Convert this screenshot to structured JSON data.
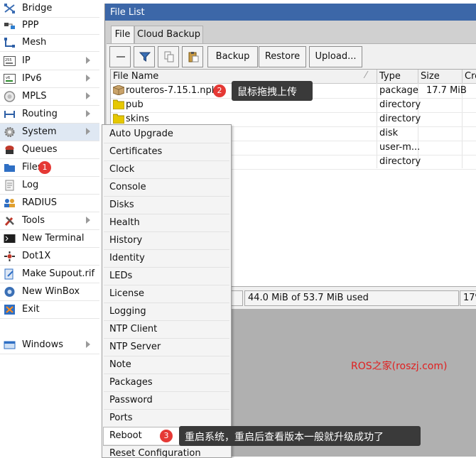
{
  "sidebar": {
    "items": [
      {
        "label": "Bridge",
        "icon": "bridge-icon",
        "submenu": false
      },
      {
        "label": "PPP",
        "icon": "ppp-icon",
        "submenu": false
      },
      {
        "label": "Mesh",
        "icon": "mesh-icon",
        "submenu": false
      },
      {
        "label": "IP",
        "icon": "ip-icon",
        "submenu": true
      },
      {
        "label": "IPv6",
        "icon": "ipv6-icon",
        "submenu": true
      },
      {
        "label": "MPLS",
        "icon": "mpls-icon",
        "submenu": true
      },
      {
        "label": "Routing",
        "icon": "routing-icon",
        "submenu": true
      },
      {
        "label": "System",
        "icon": "system-gear-icon",
        "submenu": true
      },
      {
        "label": "Queues",
        "icon": "queues-icon",
        "submenu": false
      },
      {
        "label": "Files",
        "icon": "folder-icon",
        "submenu": false
      },
      {
        "label": "Log",
        "icon": "log-icon",
        "submenu": false
      },
      {
        "label": "RADIUS",
        "icon": "radius-icon",
        "submenu": false
      },
      {
        "label": "Tools",
        "icon": "tools-icon",
        "submenu": true
      },
      {
        "label": "New Terminal",
        "icon": "terminal-icon",
        "submenu": false
      },
      {
        "label": "Dot1X",
        "icon": "dot1x-icon",
        "submenu": false
      },
      {
        "label": "Make Supout.rif",
        "icon": "supout-icon",
        "submenu": false
      },
      {
        "label": "New WinBox",
        "icon": "winbox-icon",
        "submenu": false
      },
      {
        "label": "Exit",
        "icon": "exit-icon",
        "submenu": false
      },
      {
        "label": "Windows",
        "icon": "windows-icon",
        "submenu": true
      }
    ]
  },
  "file_window": {
    "title": "File List",
    "tabs": [
      {
        "label": "File"
      },
      {
        "label": "Cloud Backup"
      }
    ],
    "toolbar": {
      "remove_icon": "minus-icon",
      "filter_icon": "filter-icon",
      "copy_icon": "copy-icon",
      "paste_icon": "paste-icon",
      "backup_label": "Backup",
      "restore_label": "Restore",
      "upload_label": "Upload..."
    },
    "table": {
      "columns": [
        "File Name",
        "Type",
        "Size",
        "Cre"
      ],
      "rows": [
        {
          "name": "routeros-7.15.1.npk",
          "type": "package",
          "size": "17.7 MiB",
          "icon": "package-icon"
        },
        {
          "name": "pub",
          "type": "directory",
          "size": "",
          "icon": "folder-icon"
        },
        {
          "name": "skins",
          "type": "directory",
          "size": "",
          "icon": "folder-icon"
        },
        {
          "name": "",
          "type": "disk",
          "size": "",
          "icon": ""
        },
        {
          "name": "",
          "type": "user-m...",
          "size": "",
          "icon": ""
        },
        {
          "name": "",
          "type": "directory",
          "size": "",
          "icon": ""
        }
      ]
    },
    "status": {
      "usage": "44.0 MiB of 53.7 MiB used",
      "percent": "17%"
    }
  },
  "system_menu": {
    "items": [
      "Auto Upgrade",
      "Certificates",
      "Clock",
      "Console",
      "Disks",
      "Health",
      "History",
      "Identity",
      "LEDs",
      "License",
      "Logging",
      "NTP Client",
      "NTP Server",
      "Note",
      "Packages",
      "Password",
      "Ports",
      "Reboot",
      "Reset Configuration"
    ],
    "active": "Reboot"
  },
  "callouts": {
    "one": {
      "number": "1"
    },
    "two": {
      "number": "2",
      "text": "鼠标拖拽上传"
    },
    "three": {
      "number": "3",
      "text": "重启系统，重启后查看版本一般就升级成功了"
    }
  },
  "watermark": "ROS之家(roszj.com)",
  "colors": {
    "titlebar": "#3c67a8",
    "badge": "#e53935",
    "watermark": "#e02020",
    "tooltip": "#3a3a3a"
  }
}
